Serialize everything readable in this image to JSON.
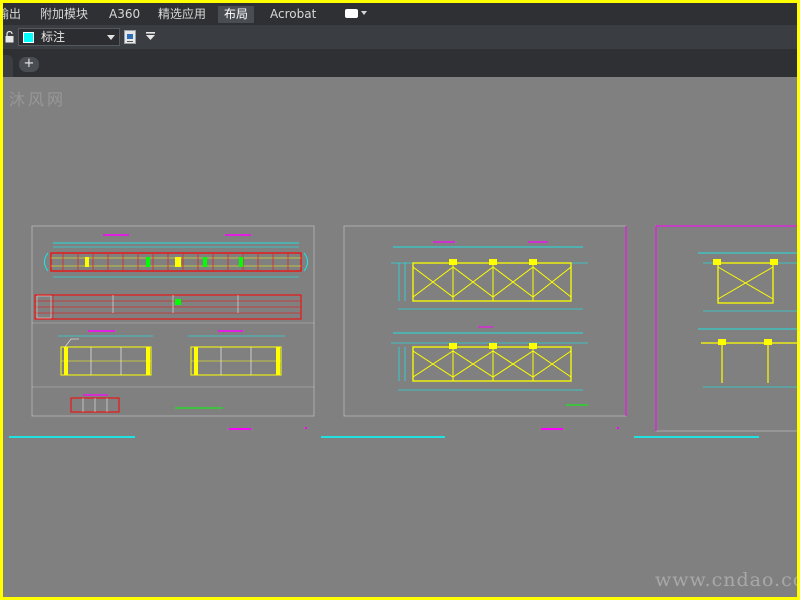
{
  "ribbon": {
    "tabs": [
      {
        "label": "输出",
        "active": false
      },
      {
        "label": "附加模块",
        "active": false
      },
      {
        "label": "A360",
        "active": false
      },
      {
        "label": "精选应用",
        "active": false
      },
      {
        "label": "布局",
        "active": true
      },
      {
        "label": "Acrobat",
        "active": false
      }
    ],
    "extra_menu_icon": "window-menu-icon"
  },
  "properties": {
    "layer": {
      "name": "标注",
      "color": "#00ffff"
    },
    "icons": [
      "lock-icon",
      "layer-properties-icon",
      "filter-icon"
    ]
  },
  "filetabs": {
    "new_tab_symbol": "+"
  },
  "watermark": {
    "top_left": "沐风网",
    "bottom_right": "www.cndao.com"
  },
  "colors": {
    "canvas": "#808080",
    "frame_border": "#ffff00",
    "cad_cyan": "#00ffff",
    "cad_yellow": "#ffff00",
    "cad_magenta": "#ff00ff",
    "cad_red": "#ff0000",
    "cad_green": "#00ff00"
  }
}
